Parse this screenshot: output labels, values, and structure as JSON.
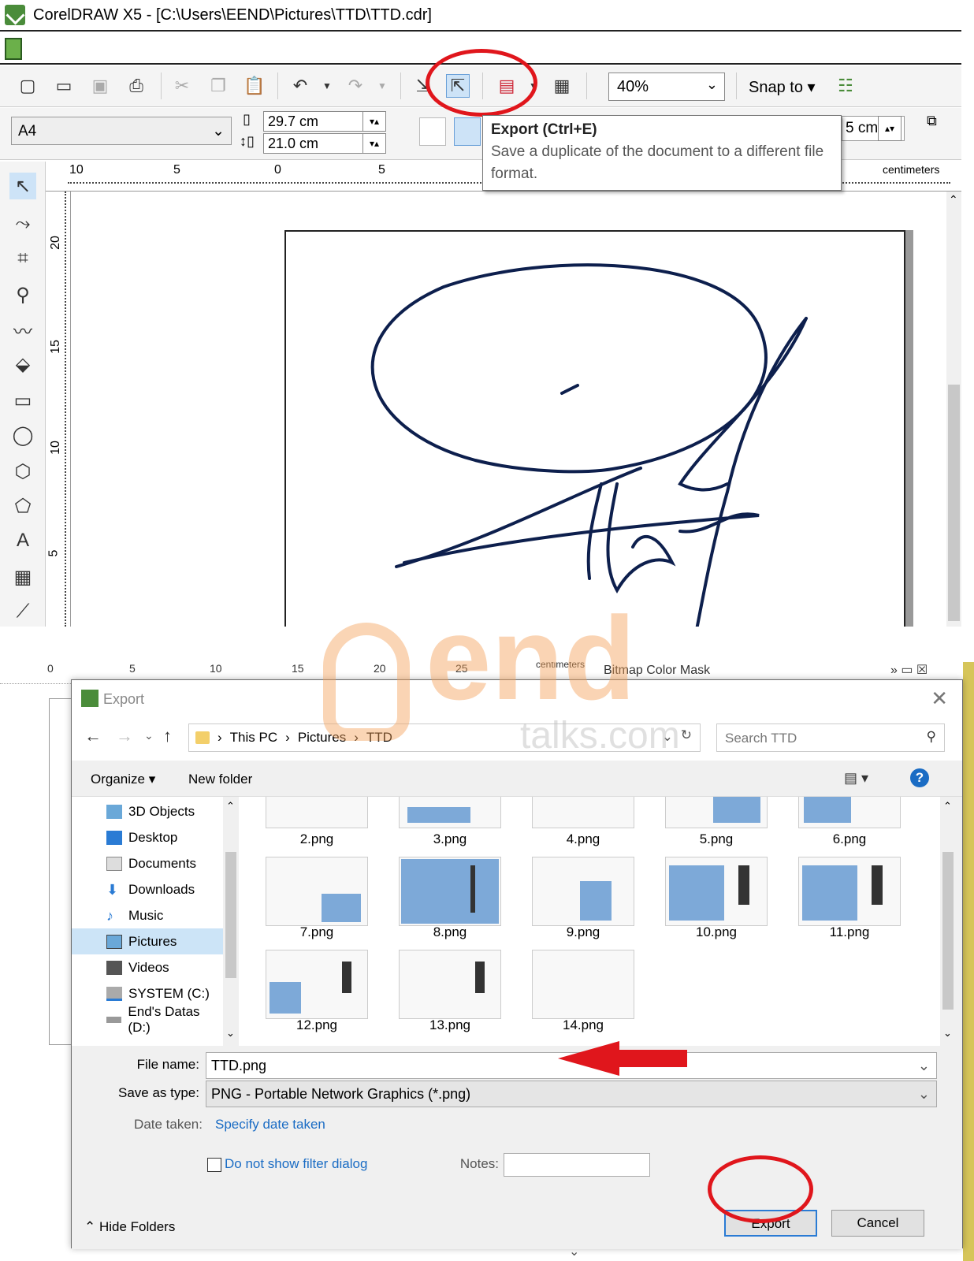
{
  "app": {
    "title": "CorelDRAW X5 - [C:\\Users\\EEND\\Pictures\\TTD\\TTD.cdr]"
  },
  "toolbar": {
    "zoom_value": "40%",
    "snap_label": "Snap to",
    "icons": [
      "new-icon",
      "open-icon",
      "save-icon",
      "print-icon",
      "cut-icon",
      "copy-icon",
      "paste-icon",
      "undo-icon",
      "redo-icon",
      "import-icon",
      "export-icon",
      "publish-pdf-icon",
      "welcome-screen-icon",
      "snap-options-icon"
    ]
  },
  "propbar": {
    "page_size": "A4",
    "width": "29.7 cm",
    "height": "21.0 cm",
    "nudge_partial": "5 cm"
  },
  "tooltip": {
    "title": "Export (Ctrl+E)",
    "body": "Save a duplicate of the document to a different file format."
  },
  "rulers": {
    "h_ticks": [
      "10",
      "5",
      "0",
      "5"
    ],
    "h_unit": "centimeters",
    "v_ticks": [
      "20",
      "15",
      "10",
      "5"
    ]
  },
  "bottom_ruler": {
    "ticks": [
      "0",
      "5",
      "10",
      "15",
      "20",
      "25"
    ],
    "unit": "centimeters",
    "docker_title": "Bitmap Color Mask"
  },
  "dialog": {
    "title": "Export",
    "breadcrumb": [
      "This PC",
      "Pictures",
      "TTD"
    ],
    "search_placeholder": "Search TTD",
    "organize": "Organize",
    "new_folder": "New folder",
    "nav_items": [
      "3D Objects",
      "Desktop",
      "Documents",
      "Downloads",
      "Music",
      "Pictures",
      "Videos",
      "SYSTEM (C:)",
      "End's Datas (D:)"
    ],
    "files": [
      "2.png",
      "3.png",
      "4.png",
      "5.png",
      "6.png",
      "7.png",
      "8.png",
      "9.png",
      "10.png",
      "11.png",
      "12.png",
      "13.png",
      "14.png"
    ],
    "file_name_label": "File name:",
    "file_name": "TTD.png",
    "save_type_label": "Save as type:",
    "save_type": "PNG - Portable Network Graphics (*.png)",
    "date_label": "Date taken:",
    "date_link": "Specify date taken",
    "no_filter": "Do not show filter dialog",
    "notes_label": "Notes:",
    "hide_folders": "Hide Folders",
    "export_btn": "Export",
    "cancel_btn": "Cancel"
  },
  "watermark": {
    "brand": "end",
    "domain": "talks.com"
  },
  "colors": {
    "highlight_red": "#e0161c",
    "accent_blue": "#1a6cc4",
    "signature": "#0d1f4d"
  }
}
